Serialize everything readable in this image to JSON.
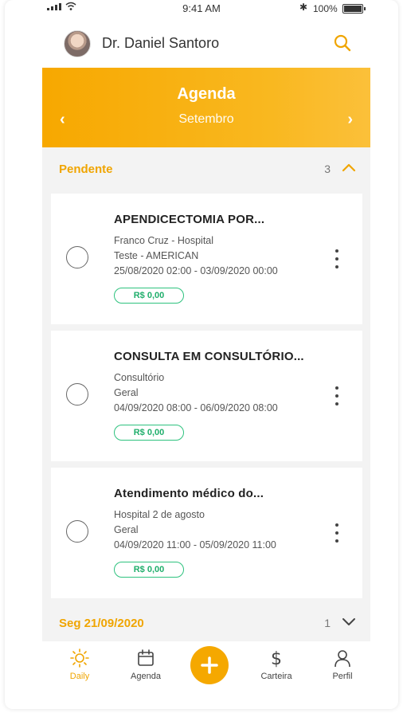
{
  "status_bar": {
    "time": "9:41 AM",
    "battery": "100%"
  },
  "header": {
    "doctor_name": "Dr. Daniel Santoro"
  },
  "agenda": {
    "title": "Agenda",
    "month": "Setembro"
  },
  "sections": [
    {
      "title": "Pendente",
      "count": "3",
      "expanded": true,
      "items": [
        {
          "title": "APENDICECTOMIA POR...",
          "line1": "Franco Cruz - Hospital",
          "line2": "Teste - AMERICAN",
          "line3": "25/08/2020 02:00 - 03/09/2020 00:00",
          "price": "R$ 0,00"
        },
        {
          "title": "CONSULTA EM CONSULTÓRIO...",
          "line1": "Consultório",
          "line2": "Geral",
          "line3": "04/09/2020 08:00 - 06/09/2020 08:00",
          "price": "R$ 0,00"
        },
        {
          "title": "Atendimento médico do...",
          "line1": "Hospital 2 de agosto",
          "line2": "Geral",
          "line3": "04/09/2020 11:00 - 05/09/2020 11:00",
          "price": "R$ 0,00"
        }
      ]
    },
    {
      "title": "Seg 21/09/2020",
      "count": "1",
      "expanded": false
    }
  ],
  "bottom_nav": [
    {
      "label": "Daily",
      "icon": "sun-icon",
      "active": true
    },
    {
      "label": "Agenda",
      "icon": "calendar-icon",
      "active": false
    },
    {
      "label": "",
      "icon": "plus-icon",
      "active": false
    },
    {
      "label": "Carteira",
      "icon": "dollar-icon",
      "active": false
    },
    {
      "label": "Perfil",
      "icon": "person-icon",
      "active": false
    }
  ],
  "colors": {
    "accent": "#F7A800",
    "price_green": "#2EC27E",
    "list_background": "#F3F3F3"
  }
}
